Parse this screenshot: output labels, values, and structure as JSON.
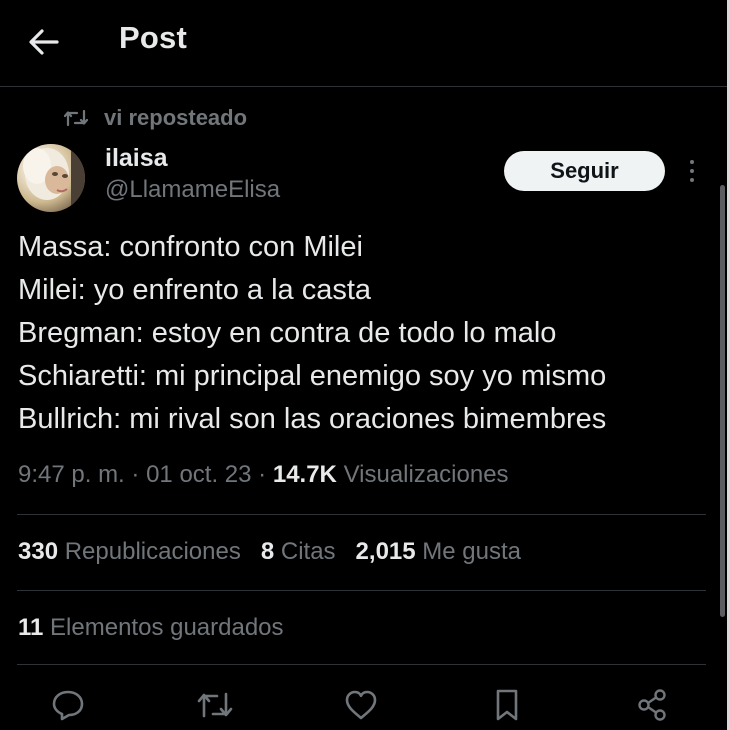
{
  "header": {
    "title": "Post",
    "back_icon": "arrow-left-icon"
  },
  "repost": {
    "label": "vi reposteado",
    "icon": "repost-icon"
  },
  "author": {
    "display_name": "ilaisa",
    "handle": "@LlamameElisa",
    "follow_label": "Seguir"
  },
  "tweet": {
    "lines": [
      "Massa: confronto con Milei",
      "Milei: yo enfrento a la casta",
      "Bregman: estoy en contra de todo lo malo",
      "Schiaretti: mi principal enemigo soy yo mismo",
      "Bullrich: mi rival son las oraciones bimembres"
    ]
  },
  "meta": {
    "time": "9:47 p. m.",
    "sep1": "·",
    "date": "01 oct. 23",
    "sep2": "·",
    "views_count": "14.7K",
    "views_label": "Visualizaciones"
  },
  "stats": {
    "reposts_count": "330",
    "reposts_label": "Republicaciones",
    "quotes_count": "8",
    "quotes_label": "Citas",
    "likes_count": "2,015",
    "likes_label": "Me gusta"
  },
  "saved": {
    "count": "11",
    "label": "Elementos guardados"
  },
  "actions": [
    "reply-icon",
    "repost-icon",
    "like-icon",
    "bookmark-icon",
    "share-icon"
  ],
  "colors": {
    "background": "#000000",
    "text": "#e7e9ea",
    "secondary": "#71767b",
    "divider": "#2f3336",
    "follow_bg": "#eff3f4"
  }
}
